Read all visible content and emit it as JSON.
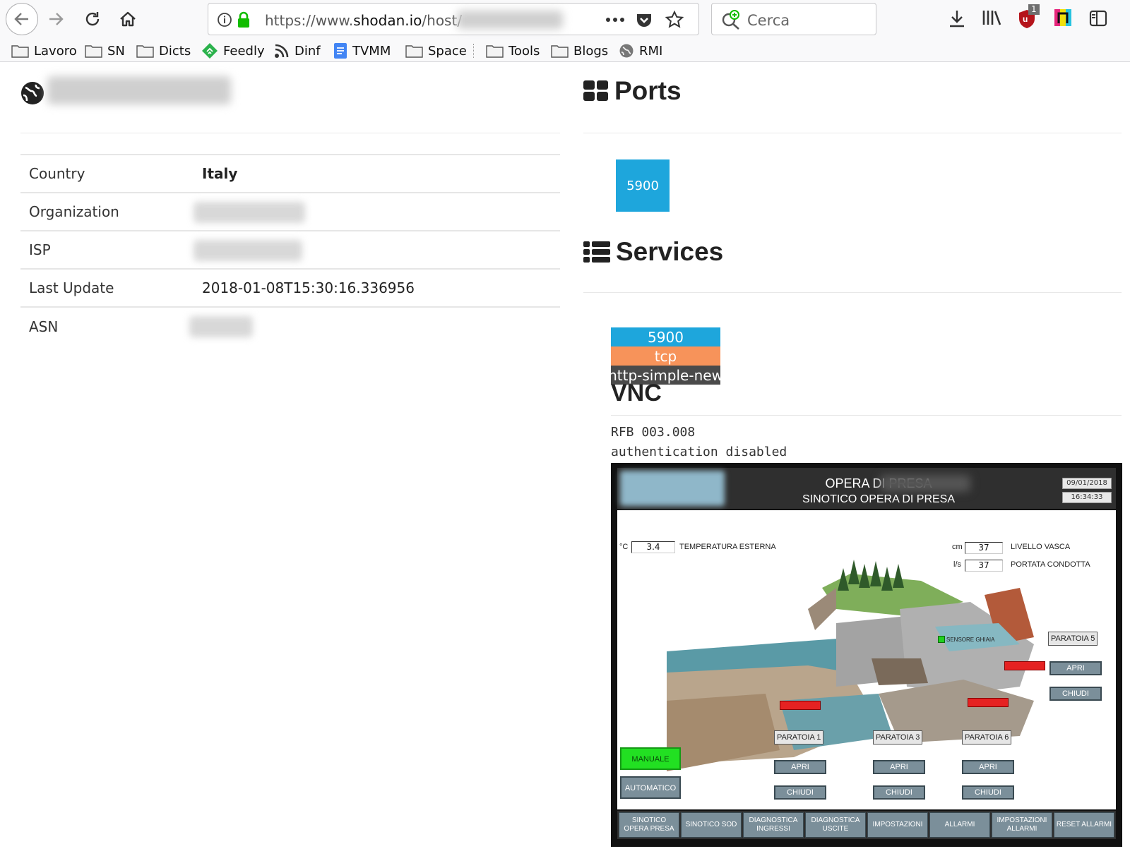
{
  "browser": {
    "url_prefix": "https://www.",
    "url_domain": "shodan.io",
    "url_path": "/host/",
    "search_placeholder": "Cerca",
    "notification_badge": "1",
    "bookmarks": [
      "Lavoro",
      "SN",
      "Dicts",
      "Feedly",
      "Dinf",
      "TVMM",
      "Space",
      "Tools",
      "Blogs",
      "RMI"
    ]
  },
  "host": {
    "info": [
      {
        "label": "Country",
        "value": "Italy"
      },
      {
        "label": "Organization",
        "value": null
      },
      {
        "label": "ISP",
        "value": null
      },
      {
        "label": "Last Update",
        "value": "2018-01-08T15:30:16.336956"
      },
      {
        "label": "ASN",
        "value": null
      }
    ]
  },
  "ports": {
    "title": "Ports",
    "list": [
      "5900"
    ]
  },
  "services": {
    "title": "Services",
    "port": "5900",
    "protocol": "tcp",
    "module": "http-simple-new",
    "name": "VNC",
    "banner": [
      "RFB 003.008",
      "authentication disabled"
    ]
  },
  "vnc": {
    "title": "OPERA DI PRESA",
    "subtitle": "SINOTICO OPERA DI PRESA",
    "date": "09/01/2018",
    "time": "16:34:33",
    "readings": {
      "temp_unit": "°C",
      "temp_value": "3.4",
      "temp_label": "TEMPERATURA ESTERNA",
      "level_unit": "cm",
      "level_value": "37",
      "level_label": "LIVELLO VASCA",
      "flow_unit": "l/s",
      "flow_value": "37",
      "flow_label": "PORTATA CONDOTTA"
    },
    "sensor_label": "SENSORE GHIAIA",
    "gates": [
      {
        "label": "PARATOIA 1",
        "open": "APRI",
        "close": "CHIUDI"
      },
      {
        "label": "PARATOIA 3",
        "open": "APRI",
        "close": "CHIUDI"
      },
      {
        "label": "PARATOIA 6",
        "open": "APRI",
        "close": "CHIUDI"
      },
      {
        "label": "PARATOIA 5",
        "open": "APRI",
        "close": "CHIUDI"
      }
    ],
    "mode_manual": "MANUALE",
    "mode_auto": "AUTOMATICO",
    "nav": [
      "SINOTICO OPERA PRESA",
      "SINOTICO SOD",
      "DIAGNOSTICA INGRESSI",
      "DIAGNOSTICA USCITE",
      "IMPOSTAZIONI",
      "ALLARMI",
      "IMPOSTAZIONI ALLARMI",
      "RESET ALLARMI"
    ]
  },
  "colors": {
    "port_blue": "#1ea6dc",
    "proto_orange": "#f7935a",
    "module_gray": "#4a4a4a",
    "alarm_red": "#e52222",
    "manual_green": "#22e022"
  }
}
